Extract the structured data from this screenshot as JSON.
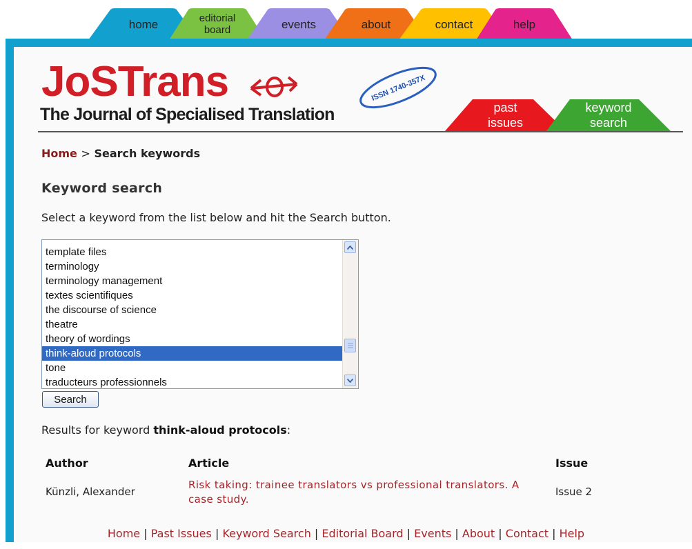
{
  "nav": {
    "tabs": [
      {
        "label": "home",
        "color": "#12a0cf"
      },
      {
        "label": "editorial board",
        "color": "#7cc242"
      },
      {
        "label": "events",
        "color": "#9b8fe3"
      },
      {
        "label": "about",
        "color": "#f07018"
      },
      {
        "label": "contact",
        "color": "#ffc000"
      },
      {
        "label": "help",
        "color": "#e4238c"
      }
    ]
  },
  "logo": {
    "title": "JoSTrans",
    "subtitle": "The Journal of Specialised Translation",
    "issn": "ISSN 1740-357X"
  },
  "side_tabs": [
    {
      "label": "past issues",
      "color": "#e8181f"
    },
    {
      "label": "keyword search",
      "color": "#3da633"
    }
  ],
  "breadcrumb": {
    "home": "Home",
    "separator": ">",
    "current": "Search keywords"
  },
  "page_title": "Keyword search",
  "instructions": "Select a keyword from the list below and hit the Search button.",
  "keyword_list": {
    "items": [
      "template files",
      "terminology",
      "terminology management",
      "textes scientifiques",
      "the discourse of science",
      "theatre",
      "theory of wordings",
      "think-aloud protocols",
      "tone",
      "traducteurs professionnels"
    ],
    "selected": "think-aloud protocols"
  },
  "search_button": "Search",
  "results": {
    "prefix": "Results for keyword",
    "keyword": "think-aloud protocols",
    "suffix": ":",
    "headers": {
      "author": "Author",
      "article": "Article",
      "issue": "Issue"
    },
    "rows": [
      {
        "author": "Künzli, Alexander",
        "article": "Risk taking: trainee translators vs professional translators. A case study.",
        "issue": "Issue 2"
      }
    ]
  },
  "footer": [
    "Home",
    "Past Issues",
    "Keyword Search",
    "Editorial Board",
    "Events",
    "About",
    "Contact",
    "Help"
  ]
}
